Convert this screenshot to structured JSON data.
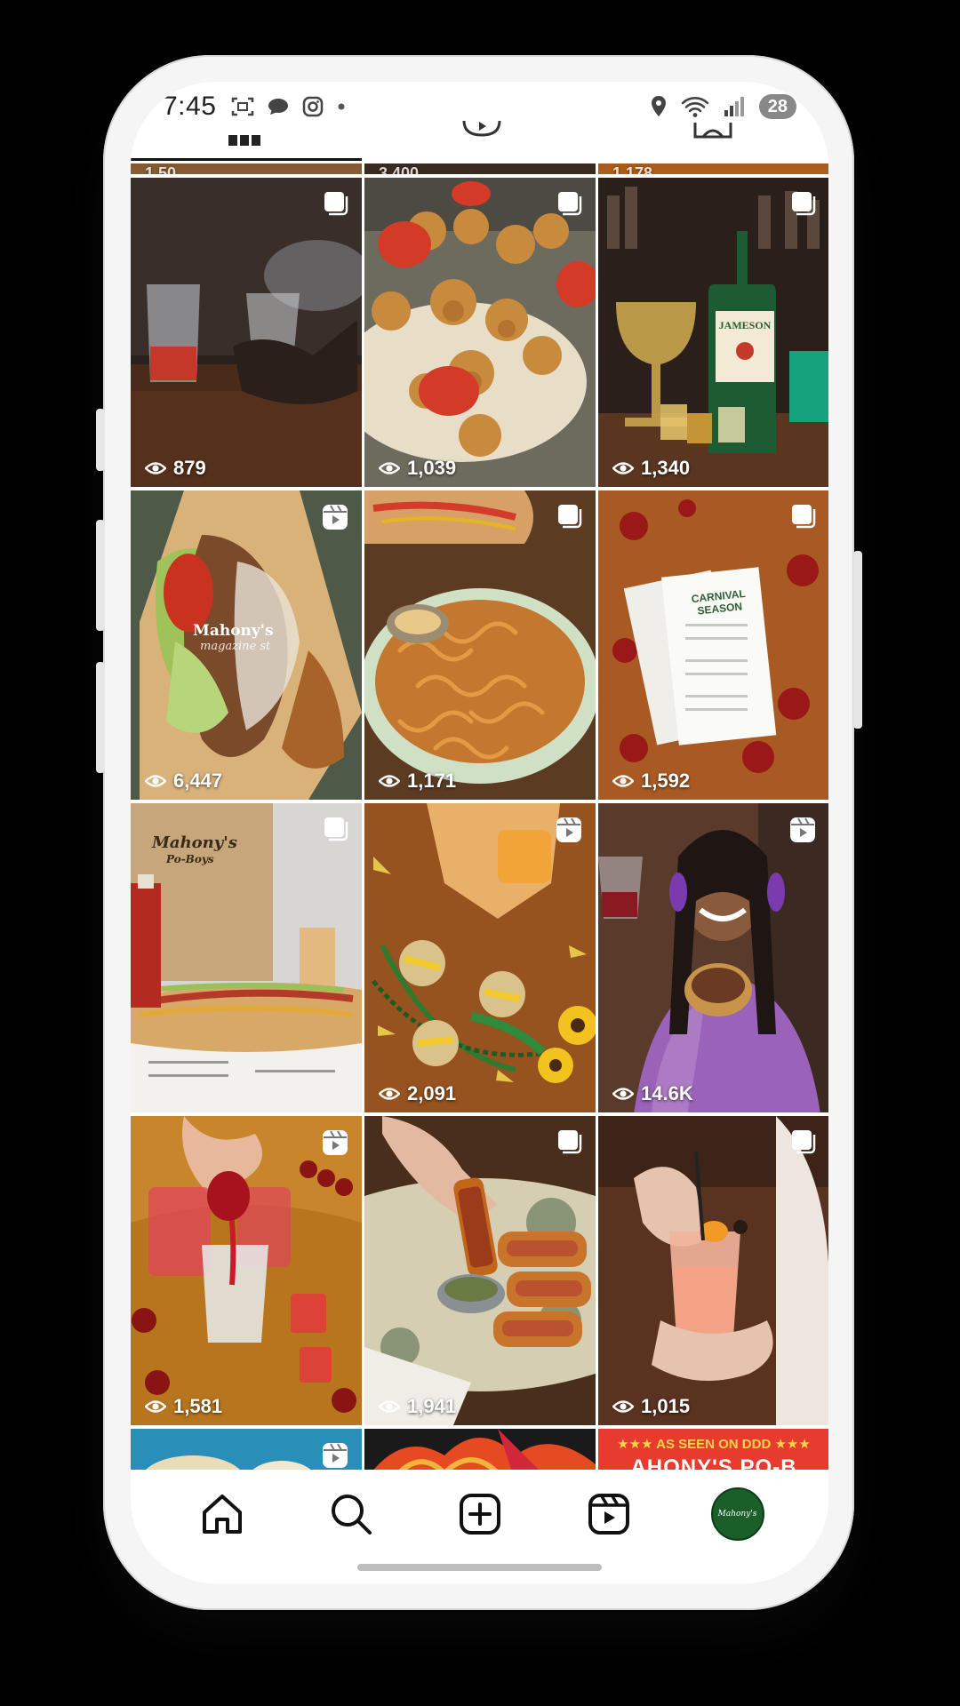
{
  "status_bar": {
    "time": "7:45",
    "battery": "28",
    "left_icons": [
      "screenshot-icon",
      "chat-bubble-icon",
      "instagram-icon",
      "dot-icon"
    ],
    "right_icons": [
      "location-icon",
      "wifi-icon",
      "signal-icon"
    ]
  },
  "grid": {
    "rows": [
      [
        {
          "views": "879",
          "type": "carousel",
          "scene": "bar-mist"
        },
        {
          "views": "1,039",
          "type": "carousel",
          "scene": "shrimp-poboy"
        },
        {
          "views": "1,340",
          "type": "carousel",
          "scene": "jameson-bar"
        }
      ],
      [
        {
          "views": "6,447",
          "type": "reel",
          "scene": "poboy-closeup"
        },
        {
          "views": "1,171",
          "type": "carousel",
          "scene": "fries-bowl"
        },
        {
          "views": "1,592",
          "type": "carousel",
          "scene": "carnival-menu"
        }
      ],
      [
        {
          "views": "",
          "type": "carousel",
          "scene": "poboy-bag"
        },
        {
          "views": "2,091",
          "type": "reel",
          "scene": "mardi-gras-drinks"
        },
        {
          "views": "14.6K",
          "type": "reel",
          "scene": "woman-sandwich"
        }
      ],
      [
        {
          "views": "1,581",
          "type": "reel",
          "scene": "red-shots"
        },
        {
          "views": "1,941",
          "type": "carousel",
          "scene": "dip-sandwich"
        },
        {
          "views": "1,015",
          "type": "carousel",
          "scene": "cocktail-hands"
        }
      ]
    ],
    "bottom_partial": [
      {
        "type": "reel",
        "scene": "blue-partial"
      },
      {
        "type": "none",
        "scene": "art-partial"
      },
      {
        "type": "none",
        "scene": "ddd-partial",
        "banner": "★★★ AS SEEN ON DDD ★★★",
        "banner_line2": "AHONY'S PO-B"
      }
    ],
    "carnival_menu": {
      "title": "CARNIVAL SEASON"
    },
    "watermark": {
      "brand": "Mahony's",
      "sub": "magazine st"
    },
    "bag_logo": {
      "line1": "Mahony's",
      "line2": "Po-Boys"
    },
    "jameson_label": "JAMESON"
  },
  "bottom_nav": {
    "items": [
      "home-icon",
      "search-icon",
      "create-icon",
      "reels-icon",
      "profile-avatar"
    ],
    "avatar_text": "Mahony's"
  },
  "colors": {
    "background": "#000000",
    "frame": "#f5f5f5",
    "avatar": "#1a5e2a",
    "ddd_banner": "#e63b2e"
  }
}
